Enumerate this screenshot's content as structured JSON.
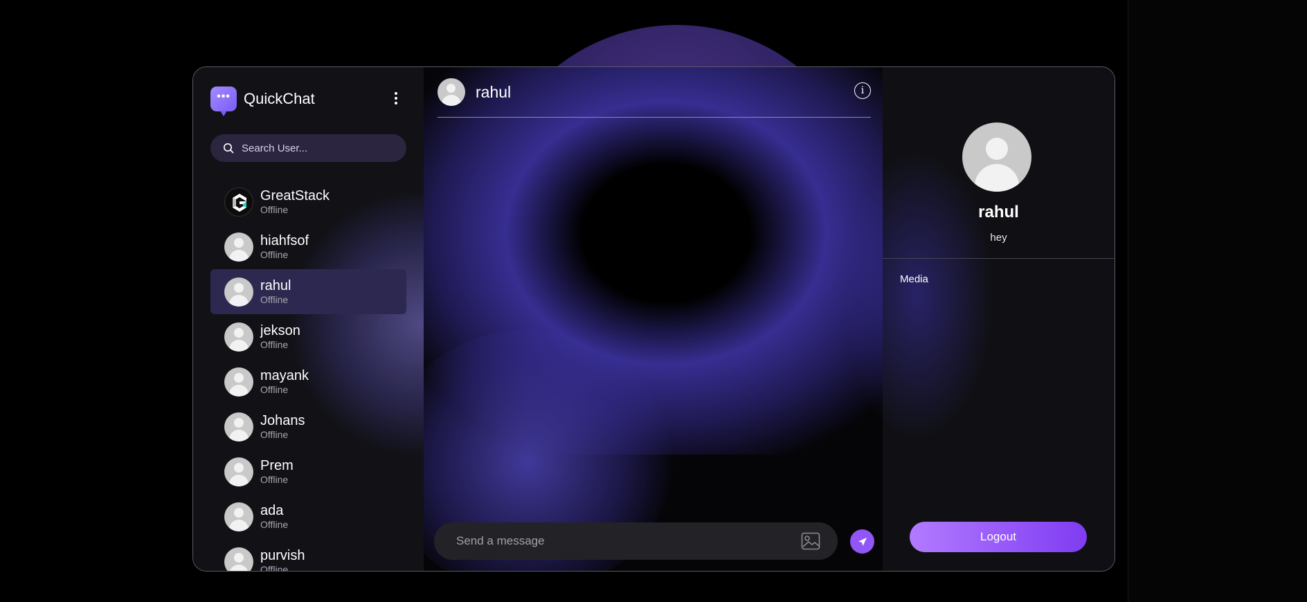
{
  "app": {
    "name": "QuickChat",
    "logo_glyph": "•••",
    "accent": "#9156f5"
  },
  "search": {
    "placeholder": "Search User..."
  },
  "users": [
    {
      "name": "GreatStack",
      "status": "Offline",
      "avatar": "greatstack-logo"
    },
    {
      "name": "hiahfsof",
      "status": "Offline",
      "avatar": "default-avatar"
    },
    {
      "name": "rahul",
      "status": "Offline",
      "avatar": "default-avatar",
      "active": true
    },
    {
      "name": "jekson",
      "status": "Offline",
      "avatar": "default-avatar"
    },
    {
      "name": "mayank",
      "status": "Offline",
      "avatar": "default-avatar"
    },
    {
      "name": "Johans",
      "status": "Offline",
      "avatar": "default-avatar"
    },
    {
      "name": "Prem",
      "status": "Offline",
      "avatar": "default-avatar"
    },
    {
      "name": "ada",
      "status": "Offline",
      "avatar": "default-avatar"
    },
    {
      "name": "purvish",
      "status": "Offline",
      "avatar": "default-avatar"
    }
  ],
  "chat": {
    "title": "rahul",
    "composer_placeholder": "Send a message"
  },
  "profile": {
    "name": "rahul",
    "bio": "hey",
    "media_label": "Media",
    "logout_label": "Logout"
  }
}
